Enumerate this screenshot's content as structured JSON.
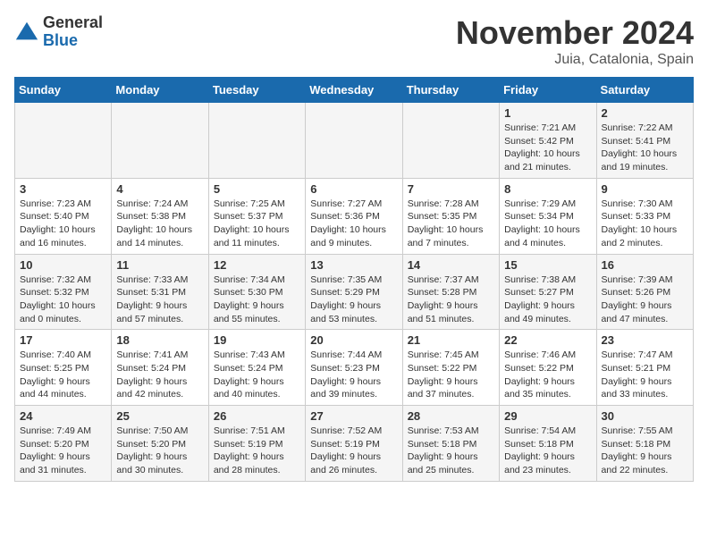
{
  "header": {
    "logo_general": "General",
    "logo_blue": "Blue",
    "month_title": "November 2024",
    "location": "Juia, Catalonia, Spain"
  },
  "days_of_week": [
    "Sunday",
    "Monday",
    "Tuesday",
    "Wednesday",
    "Thursday",
    "Friday",
    "Saturday"
  ],
  "weeks": [
    [
      {
        "day": "",
        "info": ""
      },
      {
        "day": "",
        "info": ""
      },
      {
        "day": "",
        "info": ""
      },
      {
        "day": "",
        "info": ""
      },
      {
        "day": "",
        "info": ""
      },
      {
        "day": "1",
        "info": "Sunrise: 7:21 AM\nSunset: 5:42 PM\nDaylight: 10 hours and 21 minutes."
      },
      {
        "day": "2",
        "info": "Sunrise: 7:22 AM\nSunset: 5:41 PM\nDaylight: 10 hours and 19 minutes."
      }
    ],
    [
      {
        "day": "3",
        "info": "Sunrise: 7:23 AM\nSunset: 5:40 PM\nDaylight: 10 hours and 16 minutes."
      },
      {
        "day": "4",
        "info": "Sunrise: 7:24 AM\nSunset: 5:38 PM\nDaylight: 10 hours and 14 minutes."
      },
      {
        "day": "5",
        "info": "Sunrise: 7:25 AM\nSunset: 5:37 PM\nDaylight: 10 hours and 11 minutes."
      },
      {
        "day": "6",
        "info": "Sunrise: 7:27 AM\nSunset: 5:36 PM\nDaylight: 10 hours and 9 minutes."
      },
      {
        "day": "7",
        "info": "Sunrise: 7:28 AM\nSunset: 5:35 PM\nDaylight: 10 hours and 7 minutes."
      },
      {
        "day": "8",
        "info": "Sunrise: 7:29 AM\nSunset: 5:34 PM\nDaylight: 10 hours and 4 minutes."
      },
      {
        "day": "9",
        "info": "Sunrise: 7:30 AM\nSunset: 5:33 PM\nDaylight: 10 hours and 2 minutes."
      }
    ],
    [
      {
        "day": "10",
        "info": "Sunrise: 7:32 AM\nSunset: 5:32 PM\nDaylight: 10 hours and 0 minutes."
      },
      {
        "day": "11",
        "info": "Sunrise: 7:33 AM\nSunset: 5:31 PM\nDaylight: 9 hours and 57 minutes."
      },
      {
        "day": "12",
        "info": "Sunrise: 7:34 AM\nSunset: 5:30 PM\nDaylight: 9 hours and 55 minutes."
      },
      {
        "day": "13",
        "info": "Sunrise: 7:35 AM\nSunset: 5:29 PM\nDaylight: 9 hours and 53 minutes."
      },
      {
        "day": "14",
        "info": "Sunrise: 7:37 AM\nSunset: 5:28 PM\nDaylight: 9 hours and 51 minutes."
      },
      {
        "day": "15",
        "info": "Sunrise: 7:38 AM\nSunset: 5:27 PM\nDaylight: 9 hours and 49 minutes."
      },
      {
        "day": "16",
        "info": "Sunrise: 7:39 AM\nSunset: 5:26 PM\nDaylight: 9 hours and 47 minutes."
      }
    ],
    [
      {
        "day": "17",
        "info": "Sunrise: 7:40 AM\nSunset: 5:25 PM\nDaylight: 9 hours and 44 minutes."
      },
      {
        "day": "18",
        "info": "Sunrise: 7:41 AM\nSunset: 5:24 PM\nDaylight: 9 hours and 42 minutes."
      },
      {
        "day": "19",
        "info": "Sunrise: 7:43 AM\nSunset: 5:24 PM\nDaylight: 9 hours and 40 minutes."
      },
      {
        "day": "20",
        "info": "Sunrise: 7:44 AM\nSunset: 5:23 PM\nDaylight: 9 hours and 39 minutes."
      },
      {
        "day": "21",
        "info": "Sunrise: 7:45 AM\nSunset: 5:22 PM\nDaylight: 9 hours and 37 minutes."
      },
      {
        "day": "22",
        "info": "Sunrise: 7:46 AM\nSunset: 5:22 PM\nDaylight: 9 hours and 35 minutes."
      },
      {
        "day": "23",
        "info": "Sunrise: 7:47 AM\nSunset: 5:21 PM\nDaylight: 9 hours and 33 minutes."
      }
    ],
    [
      {
        "day": "24",
        "info": "Sunrise: 7:49 AM\nSunset: 5:20 PM\nDaylight: 9 hours and 31 minutes."
      },
      {
        "day": "25",
        "info": "Sunrise: 7:50 AM\nSunset: 5:20 PM\nDaylight: 9 hours and 30 minutes."
      },
      {
        "day": "26",
        "info": "Sunrise: 7:51 AM\nSunset: 5:19 PM\nDaylight: 9 hours and 28 minutes."
      },
      {
        "day": "27",
        "info": "Sunrise: 7:52 AM\nSunset: 5:19 PM\nDaylight: 9 hours and 26 minutes."
      },
      {
        "day": "28",
        "info": "Sunrise: 7:53 AM\nSunset: 5:18 PM\nDaylight: 9 hours and 25 minutes."
      },
      {
        "day": "29",
        "info": "Sunrise: 7:54 AM\nSunset: 5:18 PM\nDaylight: 9 hours and 23 minutes."
      },
      {
        "day": "30",
        "info": "Sunrise: 7:55 AM\nSunset: 5:18 PM\nDaylight: 9 hours and 22 minutes."
      }
    ]
  ]
}
